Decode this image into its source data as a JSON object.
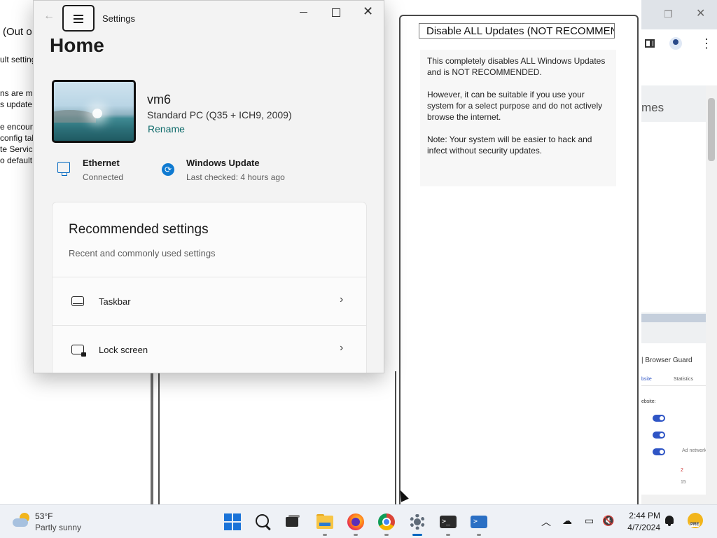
{
  "background_left": {
    "title_fragment": "(Out o",
    "lines": [
      "ult setting",
      "ns are ma",
      "s update",
      "e encount",
      "config tab",
      "te Service",
      "o default"
    ]
  },
  "update_tool": {
    "title": "Disable ALL Updates (NOT RECOMMENDED)",
    "paragraphs": [
      "This completely disables ALL Windows Updates and is NOT RECOMMENDED.",
      "However, it can be suitable if you use your system for a select purpose and do not actively browse the internet.",
      "Note: Your system will be easier to hack and infect without security updates."
    ]
  },
  "settings": {
    "app_title": "Settings",
    "page_title": "Home",
    "pc": {
      "name": "vm6",
      "model": "Standard PC (Q35 + ICH9, 2009)",
      "rename": "Rename"
    },
    "network": {
      "title": "Ethernet",
      "status": "Connected"
    },
    "update": {
      "title": "Windows Update",
      "status": "Last checked: 4 hours ago"
    },
    "recommended": {
      "title": "Recommended settings",
      "subtitle": "Recent and commonly used settings",
      "items": [
        {
          "label": "Taskbar"
        },
        {
          "label": "Lock screen"
        }
      ]
    }
  },
  "chrome": {
    "visible_text": "mes",
    "extension": {
      "header": "| Browser Guard",
      "tab_website": "bsite",
      "tab_statistics": "Statistics",
      "website_label": "ebsite:",
      "ad_label": "Ad network",
      "n1": "2",
      "n2": "15"
    }
  },
  "taskbar": {
    "weather": {
      "temp": "53°F",
      "condition": "Partly sunny"
    },
    "clock": {
      "time": "2:44 PM",
      "date": "4/7/2024"
    },
    "pre_badge": "PRE"
  }
}
